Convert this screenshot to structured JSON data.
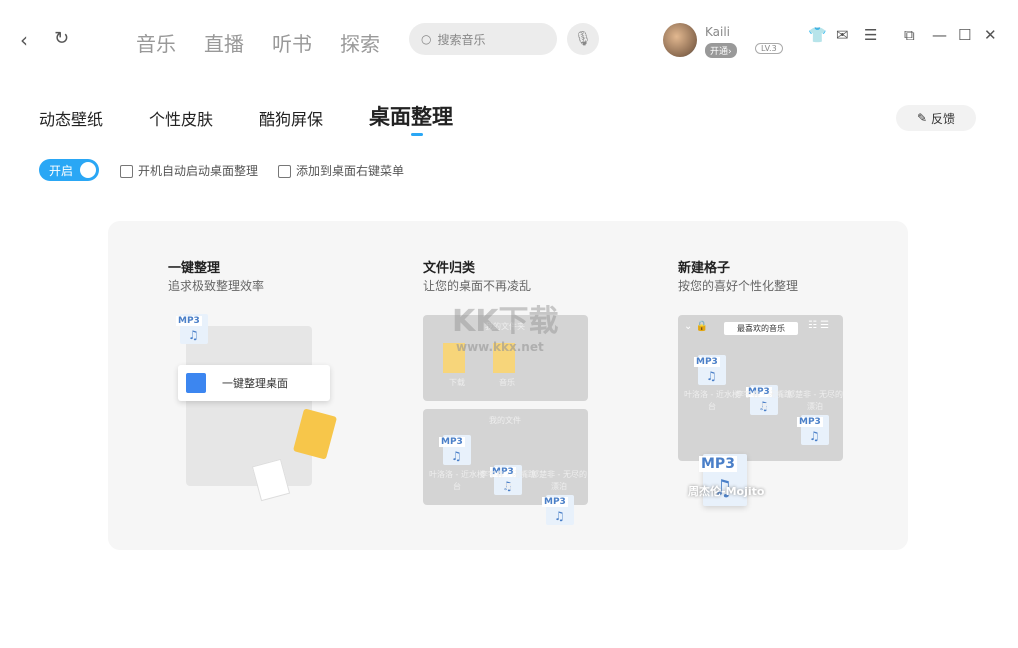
{
  "nav": {
    "items": [
      "音乐",
      "直播",
      "听书",
      "探索"
    ],
    "search_placeholder": "搜索音乐"
  },
  "user": {
    "name": "Kaili",
    "vip": "开通›",
    "level": "LV.3"
  },
  "subtabs": [
    "动态壁纸",
    "个性皮肤",
    "酷狗屏保",
    "桌面整理"
  ],
  "active_subtab": "桌面整理",
  "feedback": "反馈",
  "toggle": {
    "label": "开启",
    "on": true
  },
  "options": [
    "开机自动启动桌面整理",
    "添加到桌面右键菜单"
  ],
  "accent": "#2aa7f5",
  "features": [
    {
      "title": "一键整理",
      "desc": "追求极致整理效率",
      "button": "一键整理桌面",
      "badge": "MP3"
    },
    {
      "title": "文件归类",
      "desc": "让您的桌面不再凌乱",
      "panel1": "我的文件夹",
      "folders": [
        "下载",
        "音乐"
      ],
      "panel2": "我的文件",
      "files": [
        "叶洛洛 - 近水楼台",
        "李宇春 - 闭嘴跳舞",
        "郭楚非 - 无尽的漂泊"
      ]
    },
    {
      "title": "新建格子",
      "desc": "按您的喜好个性化整理",
      "grid_name": "最喜欢的音乐",
      "files": [
        "叶洛洛 - 近水楼台",
        "李宇春 - 闭嘴跳舞",
        "郭楚非 - 无尽的漂泊"
      ],
      "dragging": "周杰伦-Mojito"
    }
  ],
  "watermark": {
    "line1": "KK下载",
    "line2": "www.kkx.net"
  },
  "file_badge": "MP3"
}
